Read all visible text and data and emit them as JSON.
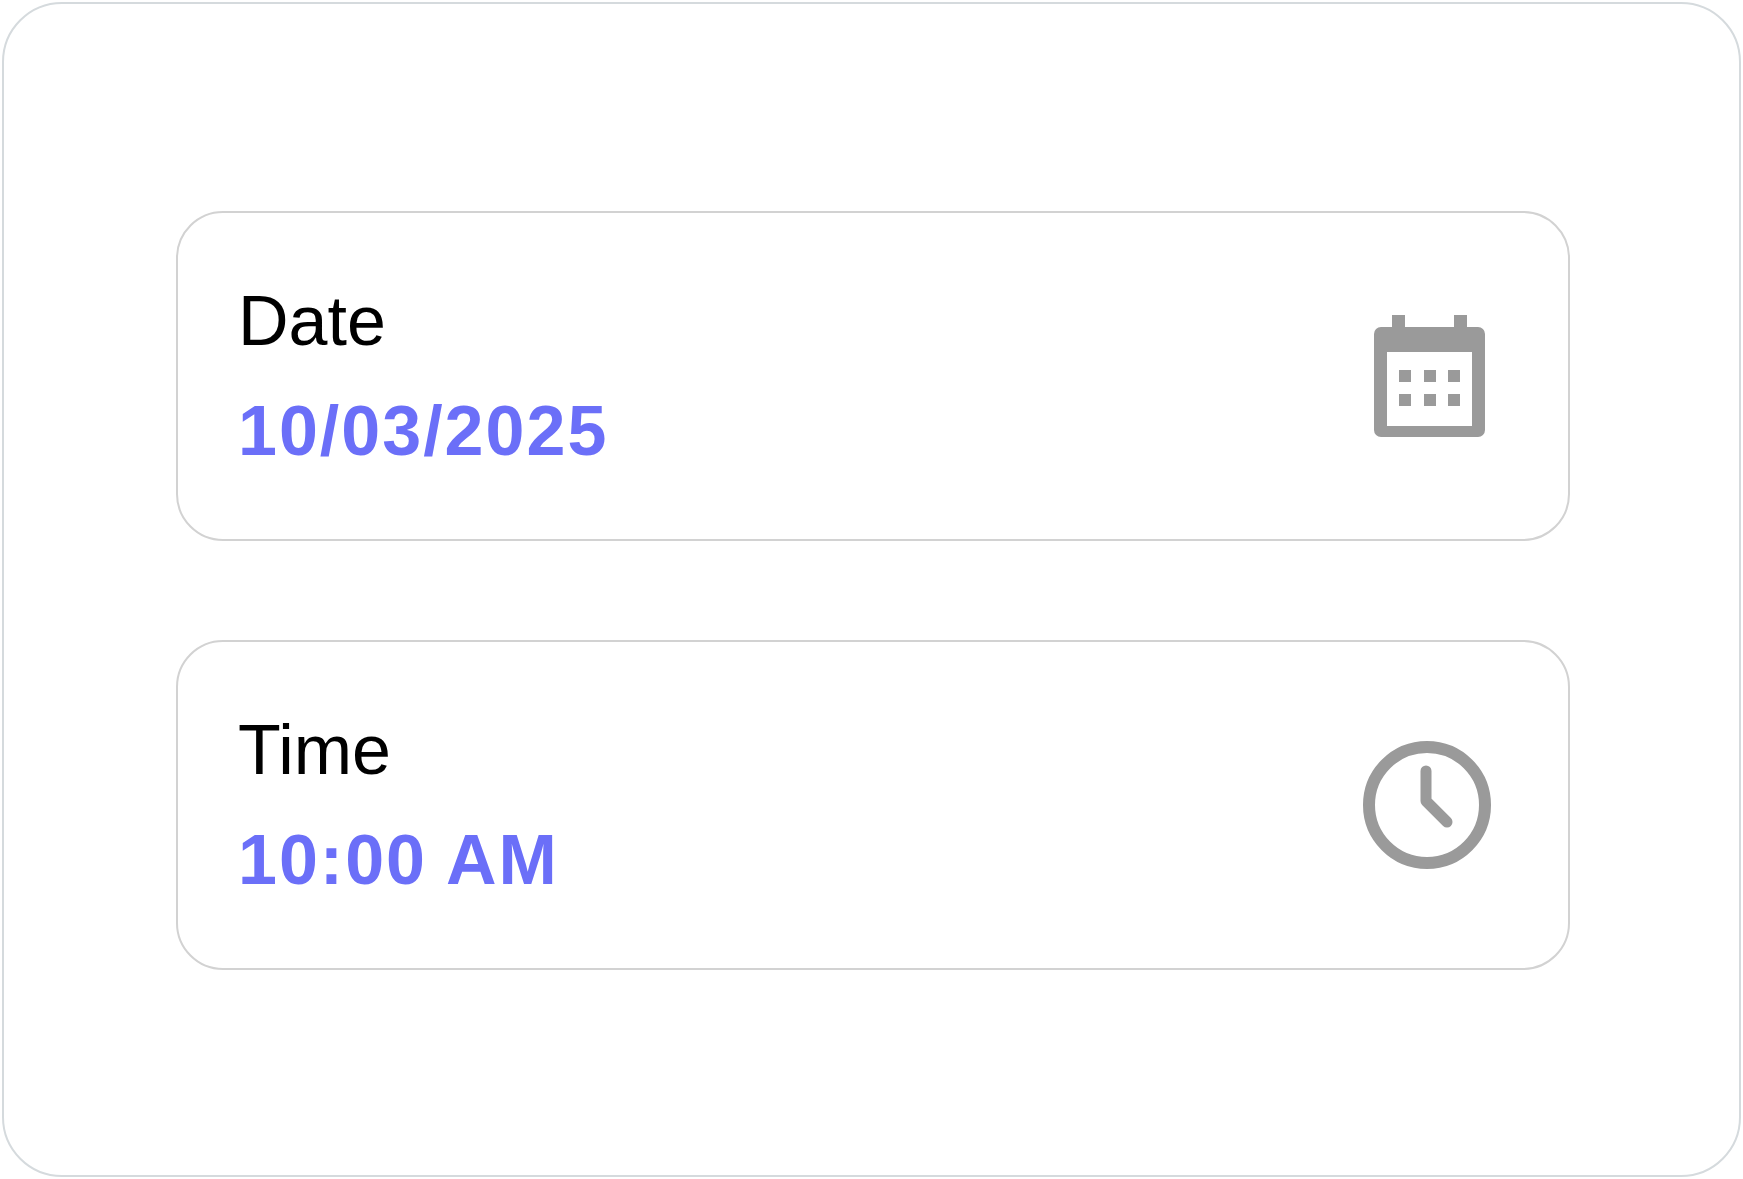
{
  "fields": [
    {
      "kind": "date",
      "label": "Date",
      "value": "10/03/2025"
    },
    {
      "kind": "time",
      "label": "Time",
      "value": "10:00 AM"
    }
  ]
}
